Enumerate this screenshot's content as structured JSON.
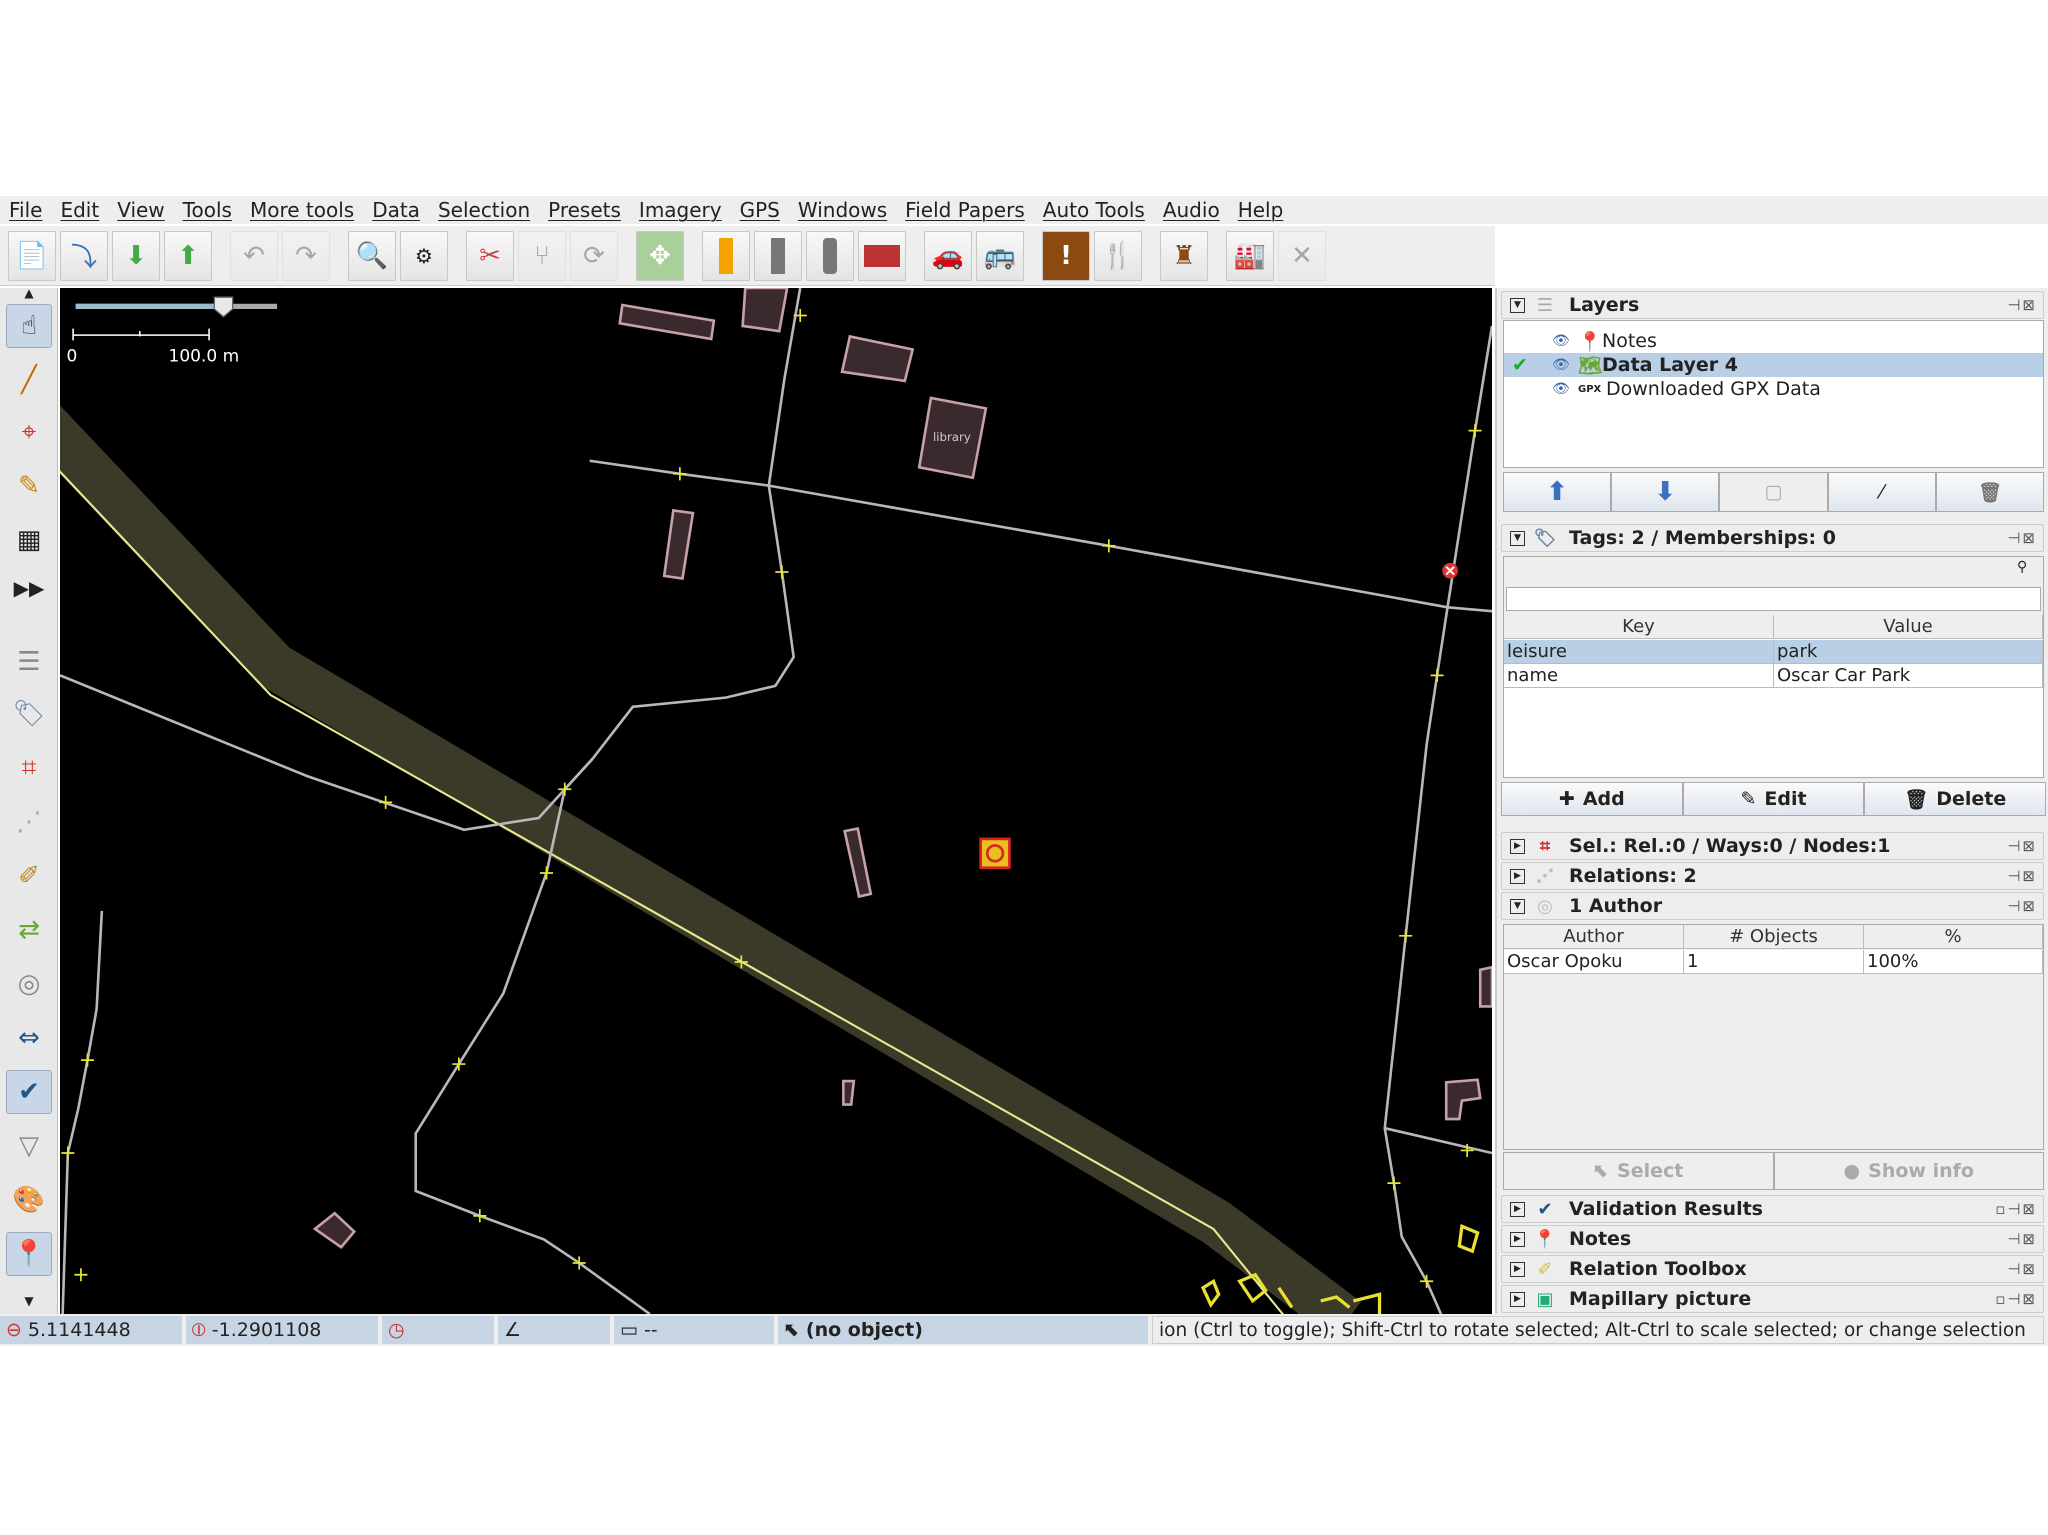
{
  "menu": [
    "File",
    "Edit",
    "View",
    "Tools",
    "More tools",
    "Data",
    "Selection",
    "Presets",
    "Imagery",
    "GPS",
    "Windows",
    "Field Papers",
    "Auto Tools",
    "Audio",
    "Help"
  ],
  "map": {
    "scale_zero": "0",
    "scale_label": "100.0 m",
    "library_label": "library"
  },
  "layers": {
    "title": "Layers",
    "items": [
      "Notes",
      "Data Layer 4",
      "Downloaded GPX Data"
    ],
    "gpx_badge": "GPX"
  },
  "tags": {
    "title": "Tags: 2 / Memberships: 0",
    "headers": [
      "Key",
      "Value"
    ],
    "rows": [
      [
        "leisure",
        "park"
      ],
      [
        "name",
        "Oscar Car Park"
      ]
    ],
    "add": "Add",
    "edit": "Edit",
    "delete": "Delete"
  },
  "selection": {
    "title": "Sel.: Rel.:0 / Ways:0 / Nodes:1"
  },
  "relations": {
    "title": "Relations: 2"
  },
  "authors": {
    "title": "1 Author",
    "headers": [
      "Author",
      "# Objects",
      "%"
    ],
    "rows": [
      [
        "Oscar Opoku",
        "1",
        "100%"
      ]
    ],
    "select": "Select",
    "show_info": "Show info"
  },
  "dialogs": [
    "Validation Results",
    "Notes",
    "Relation Toolbox",
    "Mapillary picture"
  ],
  "status": {
    "lat": "5.1141448",
    "lon": "-1.2901108",
    "distance": "--",
    "object": "(no object)",
    "help": "ion (Ctrl to toggle); Shift-Ctrl to rotate selected; Alt-Ctrl to scale selected; or change selection"
  },
  "colors": {
    "selection": "#b8cfe5",
    "map_bg": "#000000",
    "building": "#c8a0a8",
    "road": "#b8b8b8",
    "node": "#e8e830"
  }
}
